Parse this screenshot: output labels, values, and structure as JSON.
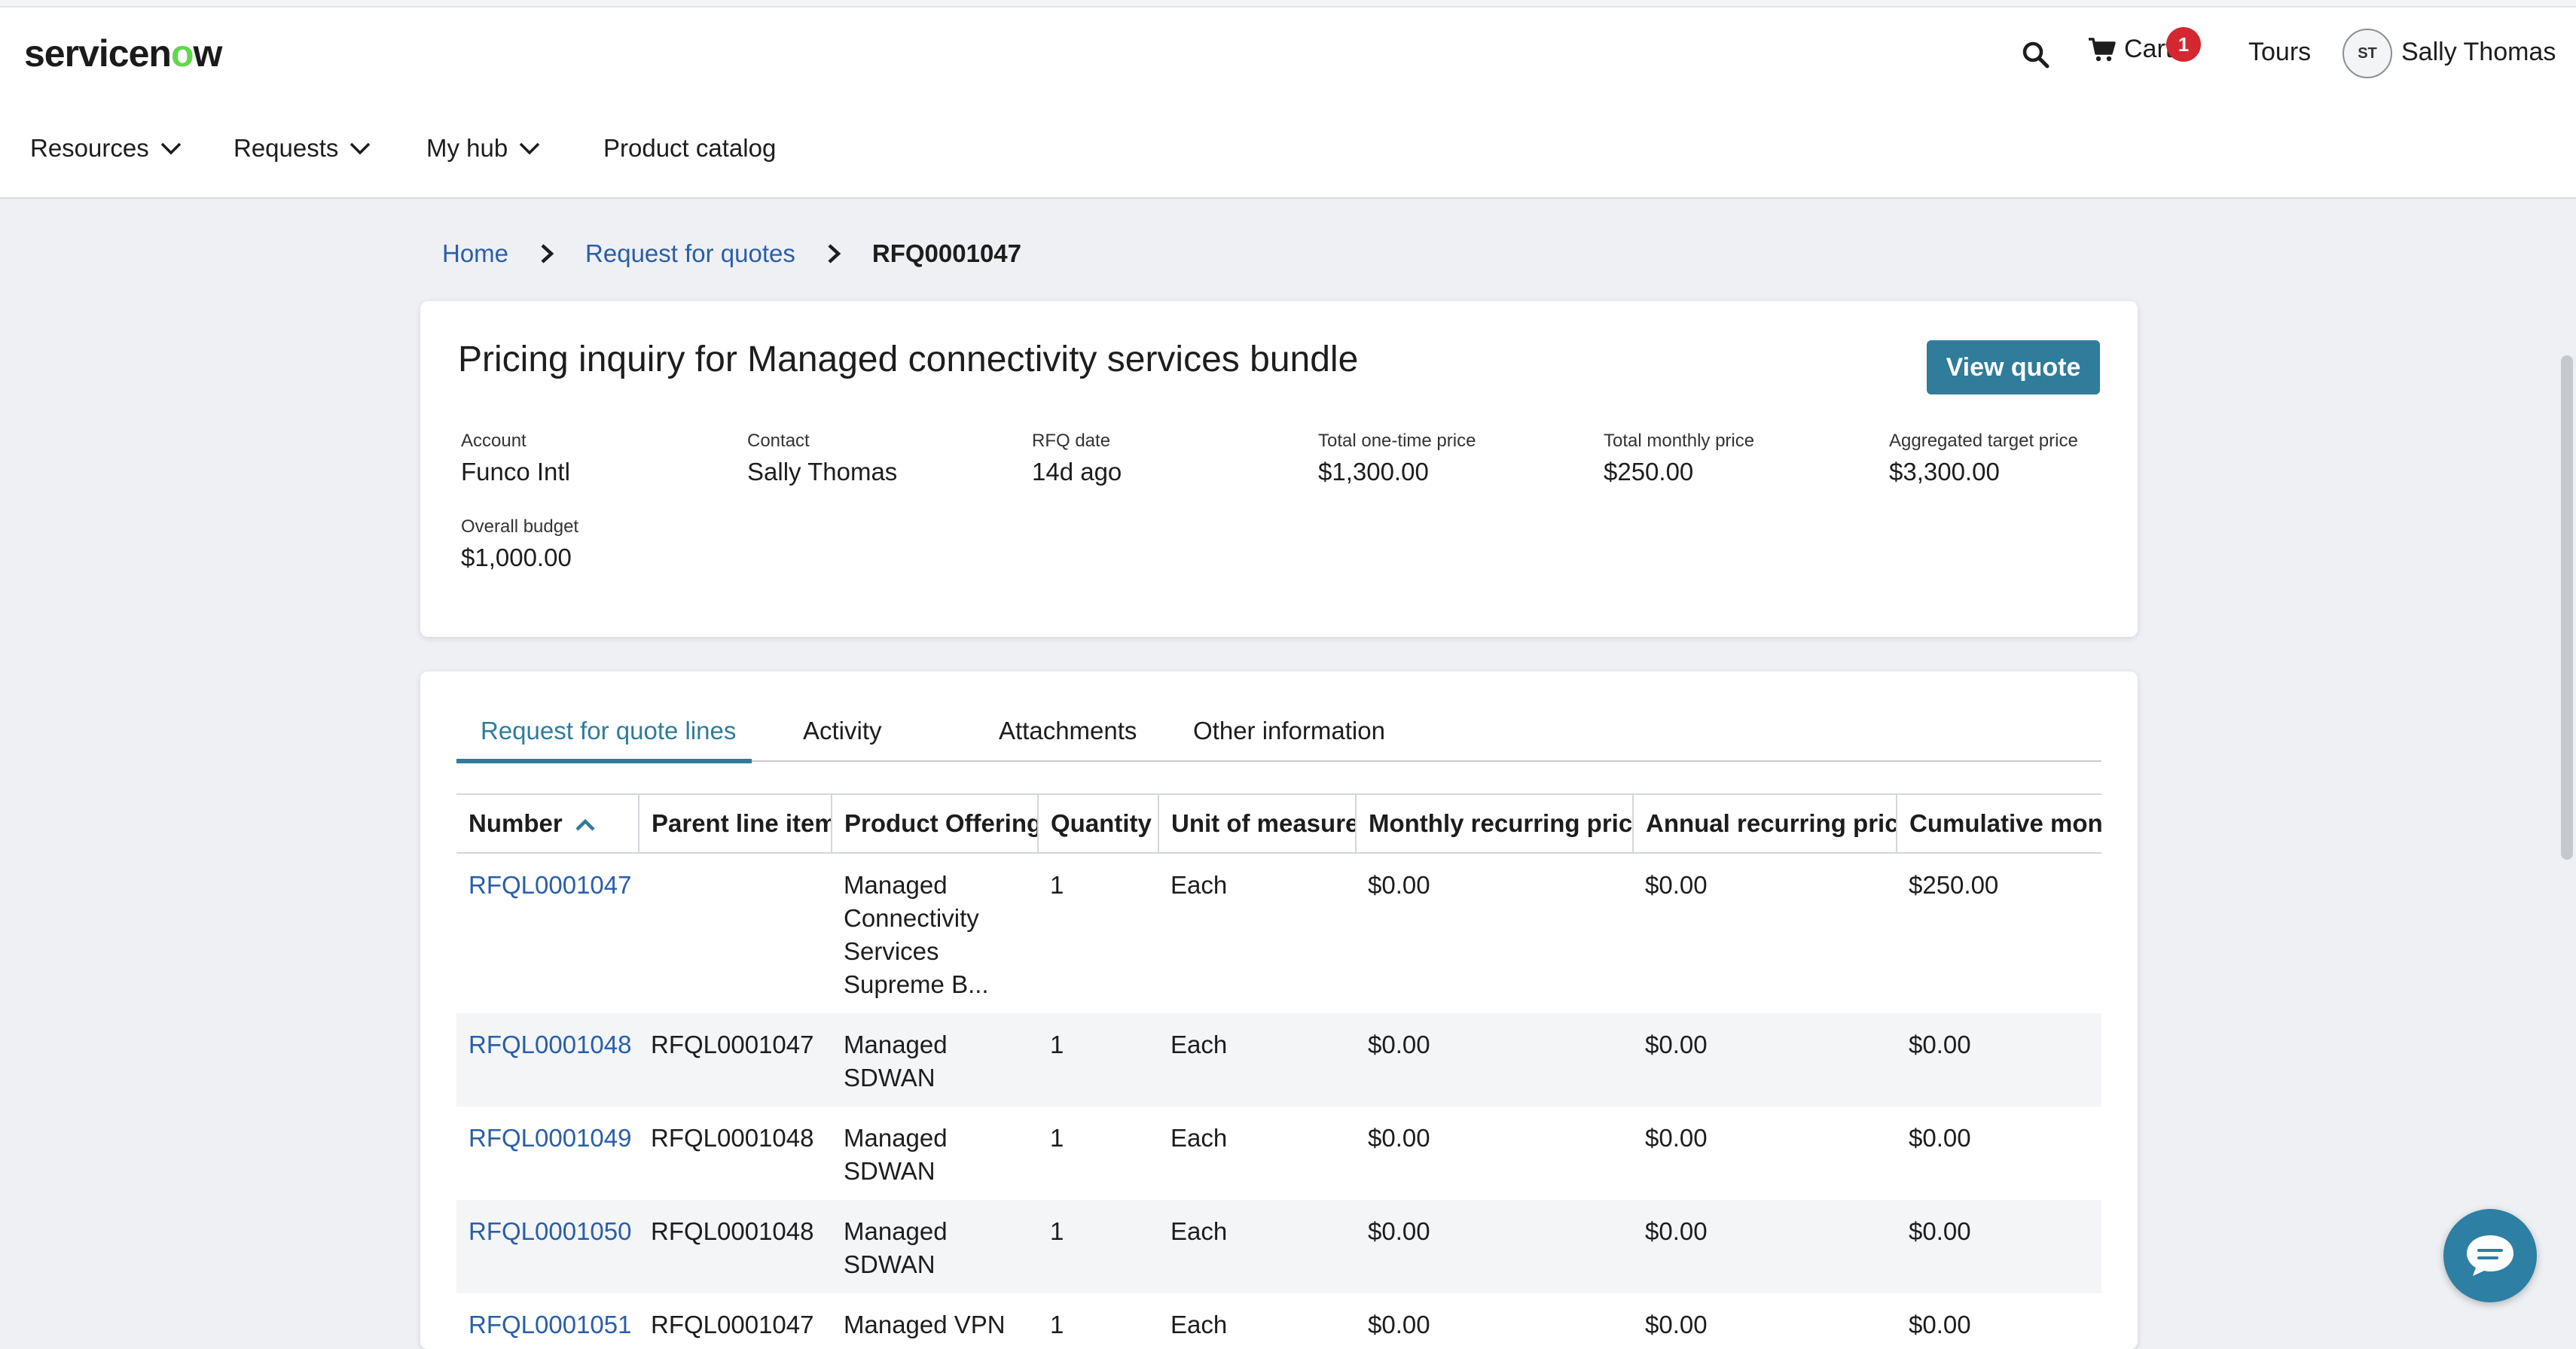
{
  "header": {
    "logo_text_pre": "servicen",
    "logo_text_o": "o",
    "logo_text_post": "w",
    "cart_label": "Cart",
    "cart_count": "1",
    "tours_label": "Tours",
    "avatar_initials": "ST",
    "user_name": "Sally Thomas",
    "nav": [
      {
        "label": "Resources"
      },
      {
        "label": "Requests"
      },
      {
        "label": "My hub"
      },
      {
        "label": "Product catalog"
      }
    ]
  },
  "breadcrumb": {
    "home": "Home",
    "rfq_list": "Request for quotes",
    "current": "RFQ0001047"
  },
  "summary": {
    "title": "Pricing inquiry for Managed connectivity services bundle",
    "view_quote_label": "View quote",
    "fields": [
      {
        "label": "Account",
        "value": "Funco Intl"
      },
      {
        "label": "Contact",
        "value": "Sally Thomas"
      },
      {
        "label": "RFQ date",
        "value": "14d ago"
      },
      {
        "label": "Total one-time price",
        "value": "$1,300.00"
      },
      {
        "label": "Total monthly price",
        "value": "$250.00"
      },
      {
        "label": "Aggregated target price",
        "value": "$3,300.00"
      },
      {
        "label": "Overall budget",
        "value": "$1,000.00"
      }
    ]
  },
  "tabs": [
    {
      "label": "Request for quote lines"
    },
    {
      "label": "Activity"
    },
    {
      "label": "Attachments"
    },
    {
      "label": "Other information"
    }
  ],
  "table": {
    "columns": [
      "Number",
      "Parent line item",
      "Product Offering",
      "Quantity",
      "Unit of measure",
      "Monthly recurring price",
      "Annual recurring price",
      "Cumulative monthly"
    ],
    "rows": [
      {
        "number": "RFQL0001047",
        "parent": "",
        "offering": "Managed Connectivity Services Supreme B...",
        "quantity": "1",
        "uom": "Each",
        "monthly": "$0.00",
        "annual": "$0.00",
        "cumulative": "$250.00"
      },
      {
        "number": "RFQL0001048",
        "parent": "RFQL0001047",
        "offering": "Managed SDWAN",
        "quantity": "1",
        "uom": "Each",
        "monthly": "$0.00",
        "annual": "$0.00",
        "cumulative": "$0.00"
      },
      {
        "number": "RFQL0001049",
        "parent": "RFQL0001048",
        "offering": "Managed SDWAN",
        "quantity": "1",
        "uom": "Each",
        "monthly": "$0.00",
        "annual": "$0.00",
        "cumulative": "$0.00"
      },
      {
        "number": "RFQL0001050",
        "parent": "RFQL0001048",
        "offering": "Managed SDWAN",
        "quantity": "1",
        "uom": "Each",
        "monthly": "$0.00",
        "annual": "$0.00",
        "cumulative": "$0.00"
      },
      {
        "number": "RFQL0001051",
        "parent": "RFQL0001047",
        "offering": "Managed VPN",
        "quantity": "1",
        "uom": "Each",
        "monthly": "$0.00",
        "annual": "$0.00",
        "cumulative": "$0.00"
      }
    ]
  },
  "colors": {
    "accent": "#2f7c9b",
    "link": "#2a5ea8",
    "badge": "#d4272f",
    "logo_o": "#62d84e"
  }
}
